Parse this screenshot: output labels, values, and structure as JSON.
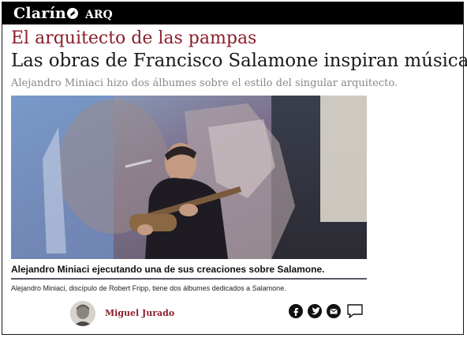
{
  "header": {
    "brand": "Clarín",
    "section": "ARQ"
  },
  "article": {
    "kicker": "El arquitecto de las pampas",
    "headline": "Las obras de Francisco Salamone inspiran música",
    "subhead": "Alejandro Miniaci hizo dos álbumes sobre el estilo del singular  arquitecto.",
    "photo_caption": "Alejandro Miniaci ejecutando una de sus creaciones sobre Salamone.",
    "photo_description": "Alejandro Miniaci, discípulo de Robert Fripp, tiene dos álbumes dedicados a Salamone."
  },
  "byline": {
    "author": "Miguel Jurado"
  },
  "share": {
    "icons": [
      "facebook-icon",
      "twitter-icon",
      "email-icon",
      "comment-icon"
    ]
  },
  "colors": {
    "brand_bar": "#000000",
    "kicker": "#8b1e2b",
    "author": "#8b1e2b"
  }
}
